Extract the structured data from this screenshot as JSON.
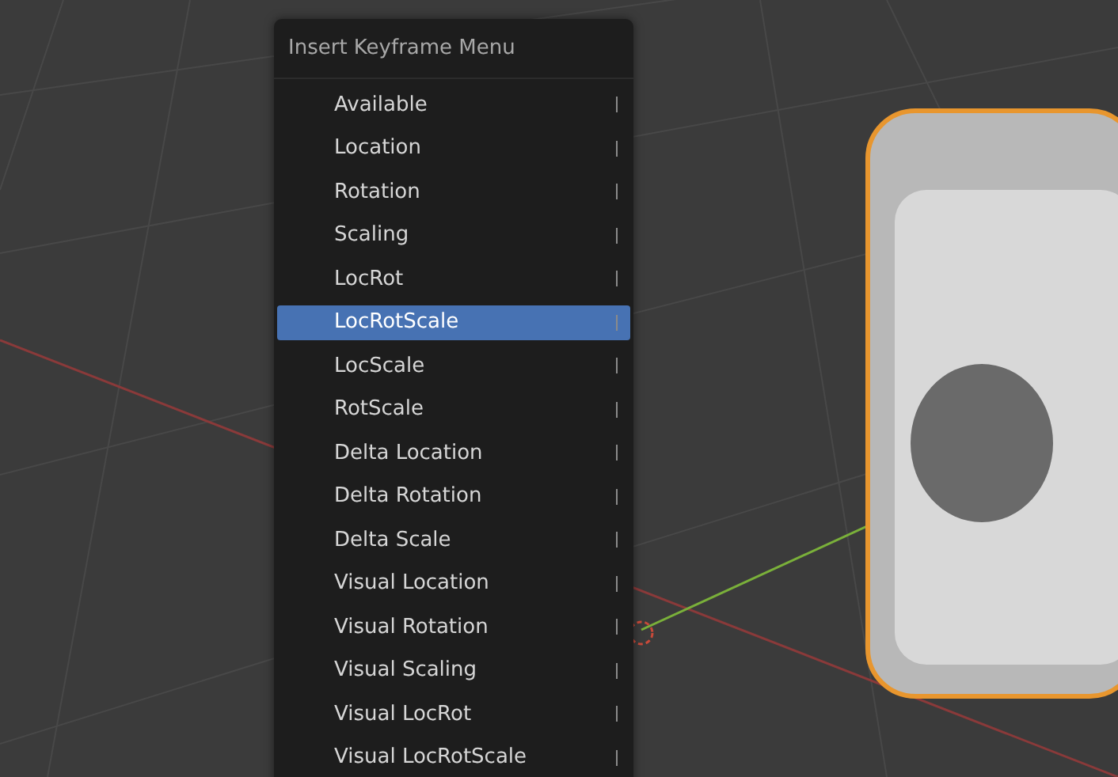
{
  "menu": {
    "title": "Insert Keyframe Menu",
    "items": [
      {
        "label": "Available",
        "selected": false
      },
      {
        "label": "Location",
        "selected": false
      },
      {
        "label": "Rotation",
        "selected": false
      },
      {
        "label": "Scaling",
        "selected": false
      },
      {
        "label": "LocRot",
        "selected": false
      },
      {
        "label": "LocRotScale",
        "selected": true
      },
      {
        "label": "LocScale",
        "selected": false
      },
      {
        "label": "RotScale",
        "selected": false
      },
      {
        "label": "Delta Location",
        "selected": false
      },
      {
        "label": "Delta Rotation",
        "selected": false
      },
      {
        "label": "Delta Scale",
        "selected": false
      },
      {
        "label": "Visual Location",
        "selected": false
      },
      {
        "label": "Visual Rotation",
        "selected": false
      },
      {
        "label": "Visual Scaling",
        "selected": false
      },
      {
        "label": "Visual LocRot",
        "selected": false
      },
      {
        "label": "Visual LocRotScale",
        "selected": false
      }
    ]
  }
}
